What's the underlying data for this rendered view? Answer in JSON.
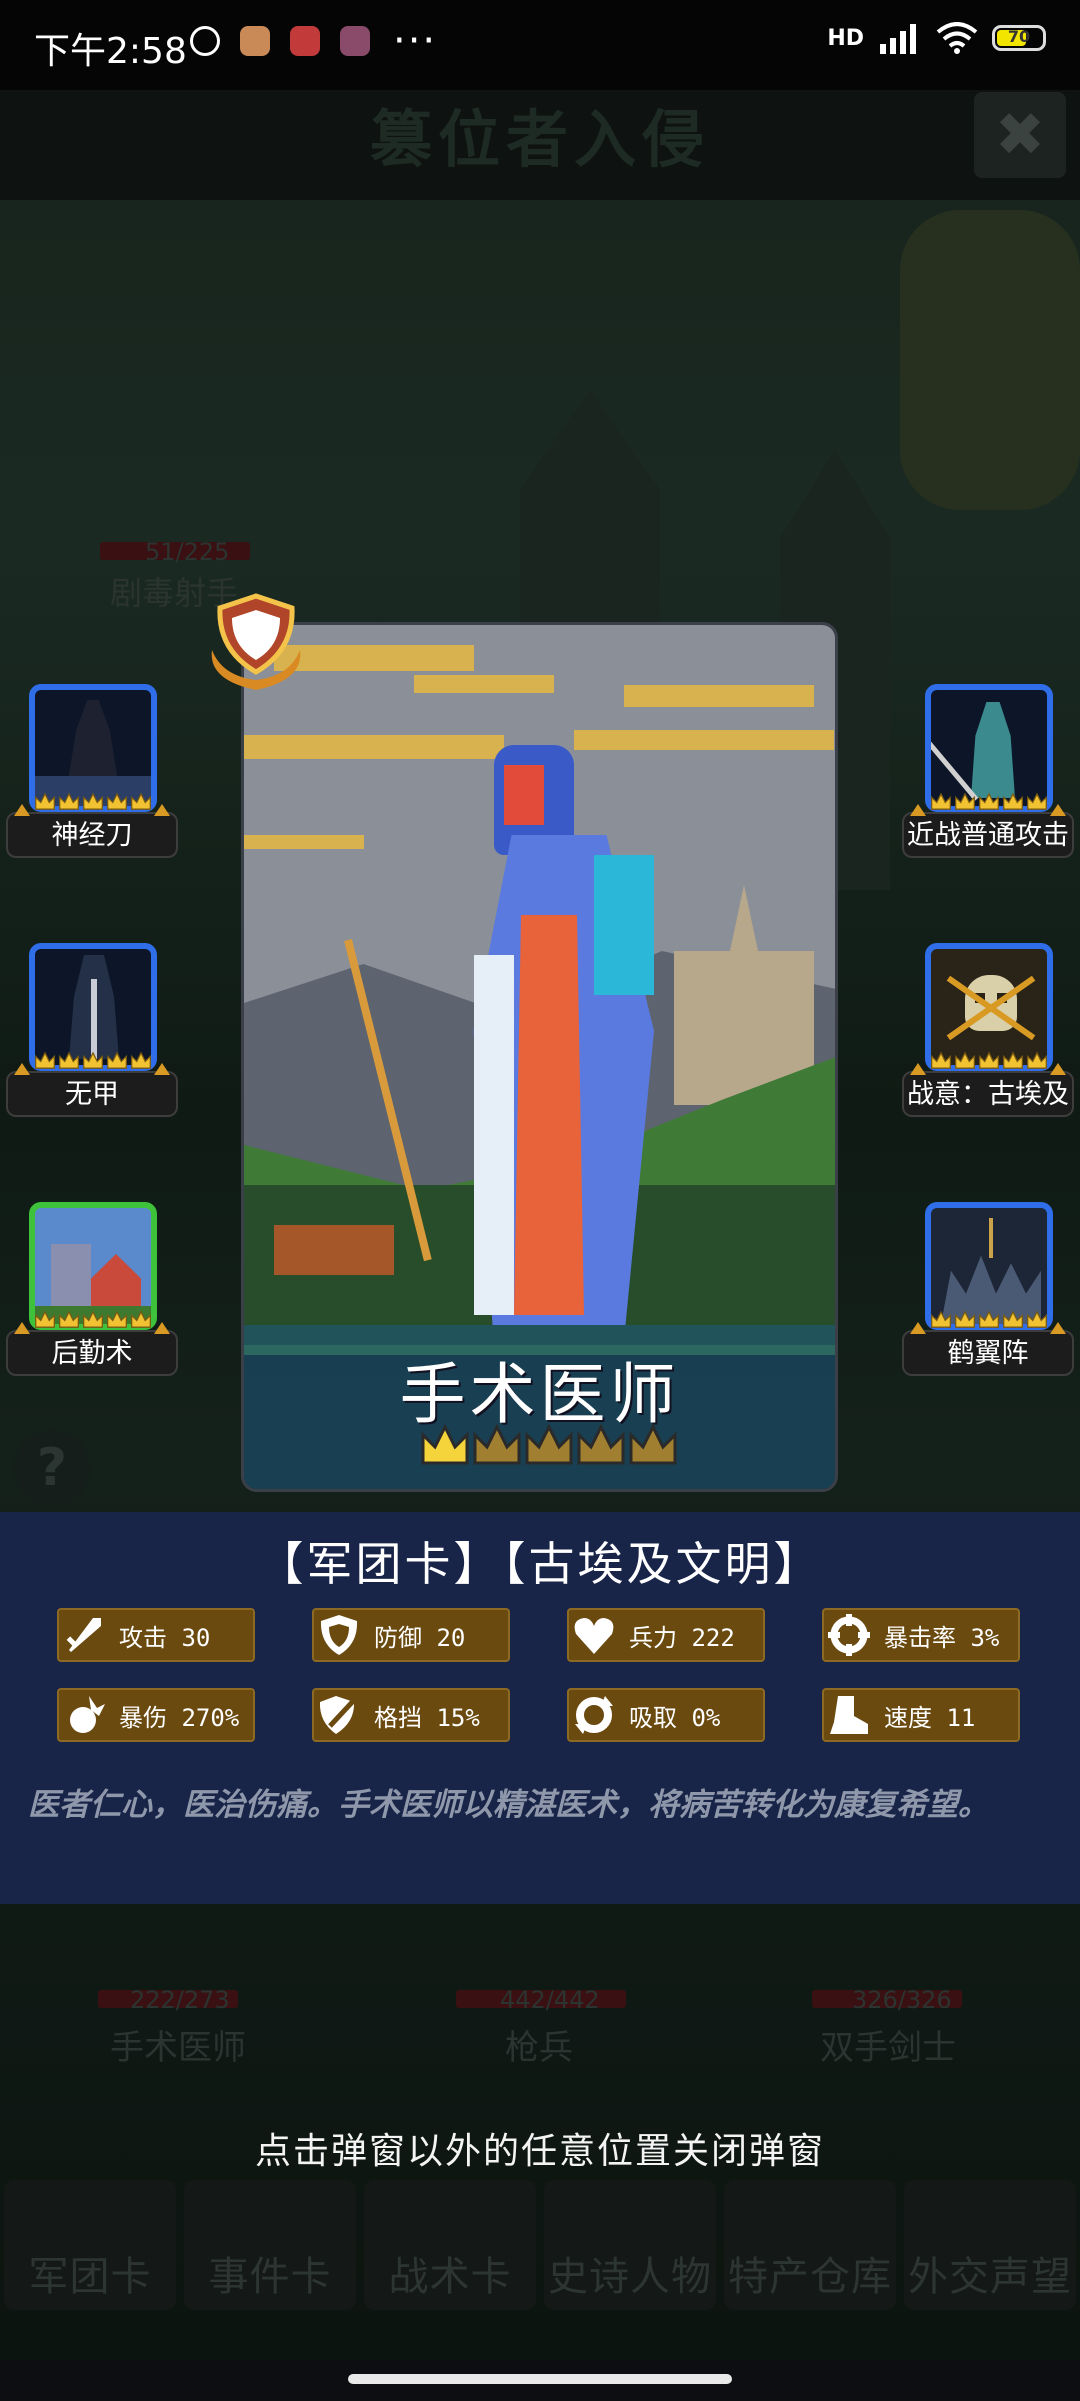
{
  "status_bar": {
    "time": "下午2:58",
    "more": "···",
    "network": "HD",
    "battery": "70"
  },
  "background": {
    "title": "篡位者入侵",
    "close_glyph": "✖",
    "hp_top": "51/225",
    "unit_top": "剧毒射手",
    "units": [
      {
        "hp": "222/273",
        "name": "手术医师"
      },
      {
        "hp": "442/442",
        "name": "枪兵"
      },
      {
        "hp": "326/326",
        "name": "双手剑士"
      }
    ],
    "help_glyph": "?"
  },
  "skills_left": [
    {
      "label": "神经刀",
      "frame": "blue"
    },
    {
      "label": "无甲",
      "frame": "blue"
    },
    {
      "label": "后勤术",
      "frame": "green"
    }
  ],
  "skills_right": [
    {
      "label": "近战普通攻击",
      "frame": "blue"
    },
    {
      "label": "战意：古埃及",
      "frame": "blue"
    },
    {
      "label": "鹤翼阵",
      "frame": "blue"
    }
  ],
  "card": {
    "name": "手术医师",
    "stars_total": 5,
    "stars_filled": 1
  },
  "info": {
    "tags": "【军团卡】【古埃及文明】",
    "stats": [
      {
        "icon": "sword-icon",
        "text": "攻击 30"
      },
      {
        "icon": "shield-icon",
        "text": "防御 20"
      },
      {
        "icon": "heart-icon",
        "text": "兵力 222"
      },
      {
        "icon": "crosshair-icon",
        "text": "暴击率 3%"
      },
      {
        "icon": "burst-icon",
        "text": "暴伤 270%"
      },
      {
        "icon": "block-icon",
        "text": "格挡 15%"
      },
      {
        "icon": "drain-icon",
        "text": "吸取 0%"
      },
      {
        "icon": "boot-icon",
        "text": "速度 11"
      }
    ],
    "description": "医者仁心，医治伤痛。手术医师以精湛医术，将病苦转化为康复希望。"
  },
  "close_hint": "点击弹窗以外的任意位置关闭弹窗",
  "bottom_nav": [
    "军团卡",
    "事件卡",
    "战术卡",
    "史诗人物",
    "特产仓库",
    "外交声望"
  ],
  "colors": {
    "accent_gold": "#d99a23",
    "frame_blue": "#2f6ee8",
    "frame_green": "#3ec23b",
    "panel": "#182448"
  }
}
